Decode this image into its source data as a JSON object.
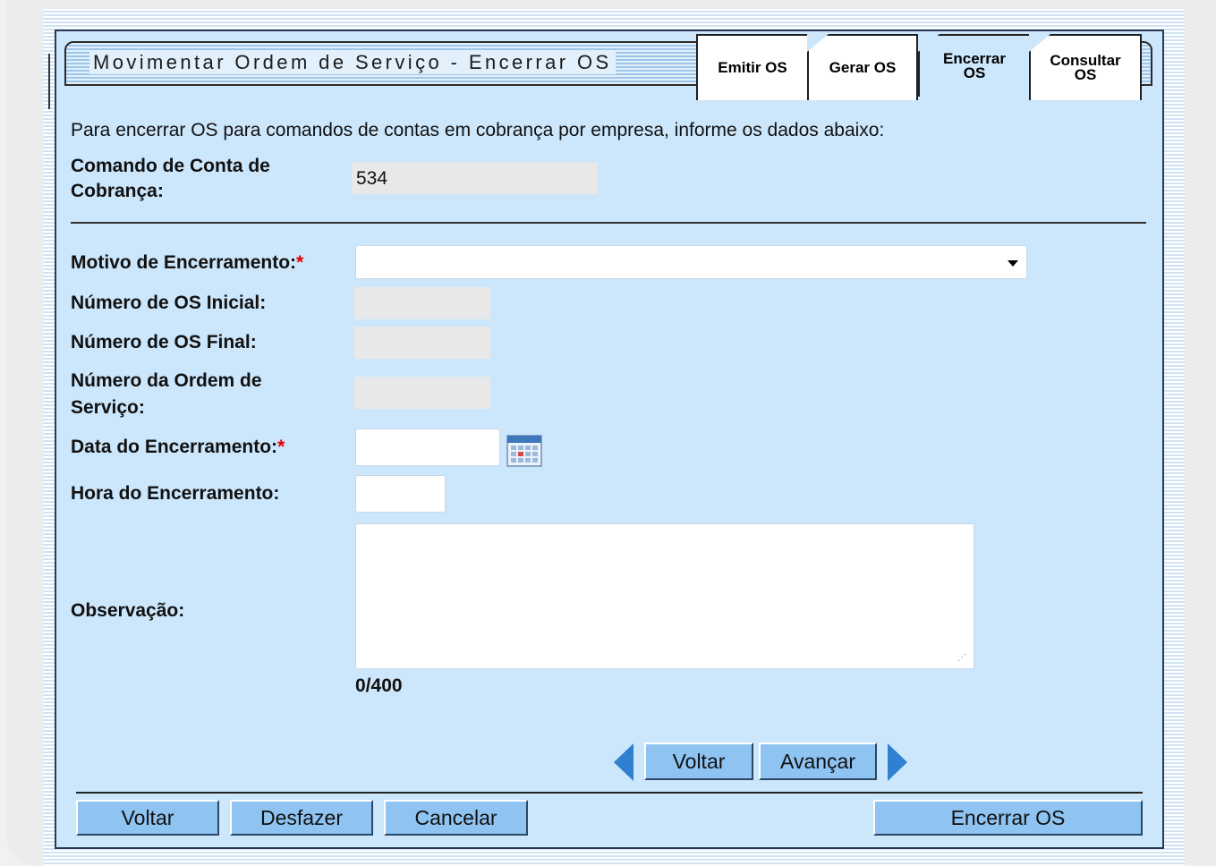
{
  "header": {
    "title": "Movimentar Ordem de Serviço - Encerrar OS",
    "tabs": [
      {
        "label_line1": "Emitir OS",
        "label_line2": ""
      },
      {
        "label_line1": "Gerar OS",
        "label_line2": ""
      },
      {
        "label_line1": "Encerrar",
        "label_line2": "OS"
      },
      {
        "label_line1": "Consultar",
        "label_line2": "OS"
      }
    ]
  },
  "form": {
    "intro": "Para encerrar OS para comandos de contas em cobrança por empresa, informe os dados abaixo:",
    "comando": {
      "label_line1": "Comando de Conta de",
      "label_line2": "Cobrança:",
      "value": "534"
    },
    "motivo": {
      "label": "Motivo de Encerramento:",
      "required": "*",
      "value": ""
    },
    "os_inicial": {
      "label": "Número de OS Inicial:",
      "value": ""
    },
    "os_final": {
      "label": "Número de OS Final:",
      "value": ""
    },
    "ordem_servico": {
      "label_line1": "Número da Ordem de",
      "label_line2": "Serviço:",
      "value": ""
    },
    "data": {
      "label": "Data do Encerramento:",
      "required": "*",
      "value": ""
    },
    "hora": {
      "label": "Hora do Encerramento:",
      "value": ""
    },
    "observacao": {
      "label": "Observação:",
      "value": "",
      "counter": "0/400"
    }
  },
  "nav": {
    "back": "Voltar",
    "next": "Avançar"
  },
  "footer": {
    "voltar": "Voltar",
    "desfazer": "Desfazer",
    "cancelar": "Cancelar",
    "encerrar": "Encerrar OS"
  },
  "colors": {
    "panel": "#cce6fb",
    "button": "#8ec3f2",
    "arrow": "#2f80d0",
    "required": "#e00000"
  }
}
